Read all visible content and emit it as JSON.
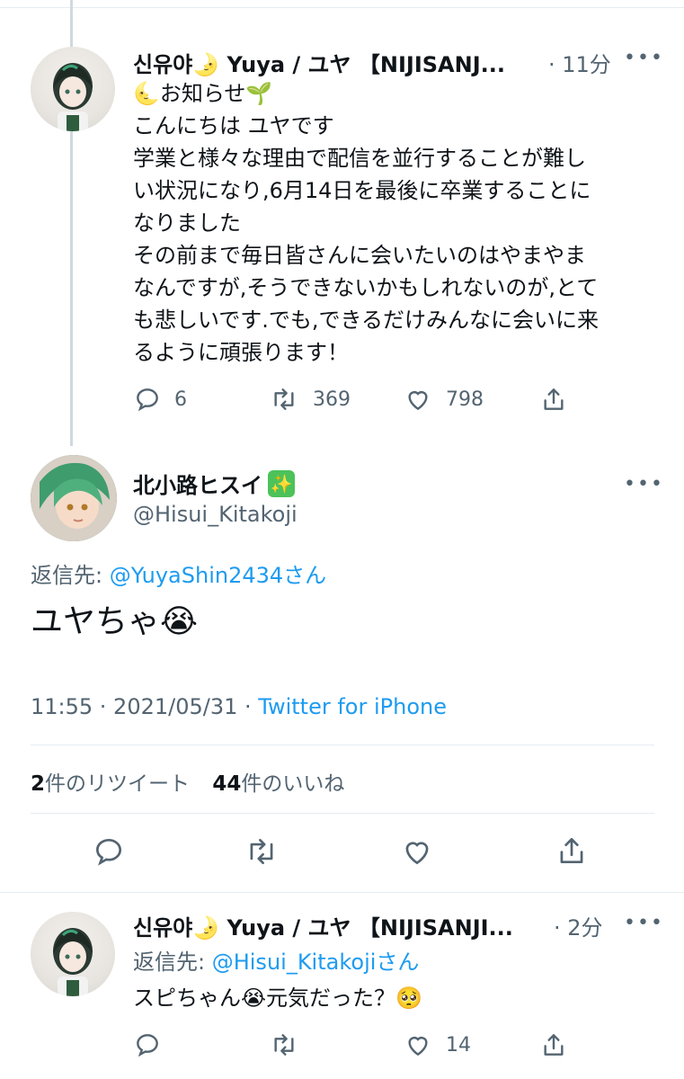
{
  "tweet1": {
    "name": "신유야🌛 Yuya / ユヤ 【NIJISANJ...",
    "time": "· 11分",
    "line_announce": "🌜お知らせ🌱",
    "text": "こんにちは ユヤです\n学業と様々な理由で配信を並行することが難し\nい状況になり,6月14日を最後に卒業することに\nなりました\nその前まで毎日皆さんに会いたいのはやまやま\nなんですが,そうできないかもしれないのが,とて\nも悲しいです.でも,できるだけみんなに会いに来\nるように頑張ります！",
    "replies": "6",
    "retweets": "369",
    "likes": "798"
  },
  "main": {
    "name": "北小路ヒスイ✳",
    "name_text": "北小路ヒスイ",
    "badge": "✨",
    "handle": "@Hisui_Kitakoji",
    "reply_prefix": "返信先: ",
    "reply_to": "@YuyaShin2434",
    "reply_suffix": "さん",
    "text": "ユヤちゃ😭",
    "timestamp": "11:55 · 2021/05/31 · ",
    "source": "Twitter for iPhone",
    "retweet_count": "2",
    "retweet_label": "件のリツイート",
    "like_count": "44",
    "like_label": "件のいいね"
  },
  "tweet3": {
    "name": "신유야🌛 Yuya / ユヤ 【NIJISANJI...",
    "time": "· 2分",
    "reply_prefix": "返信先: ",
    "reply_to": "@Hisui_Kitakoji",
    "reply_suffix": "さん",
    "text": "スピちゃん😭元気だった？🥺",
    "likes": "14"
  },
  "icons": [
    "reply-icon",
    "retweet-icon",
    "like-icon",
    "share-icon",
    "more-icon"
  ],
  "colors": {
    "link": "#1d9bf0",
    "muted": "#536471",
    "divider": "#e6ecf0"
  }
}
